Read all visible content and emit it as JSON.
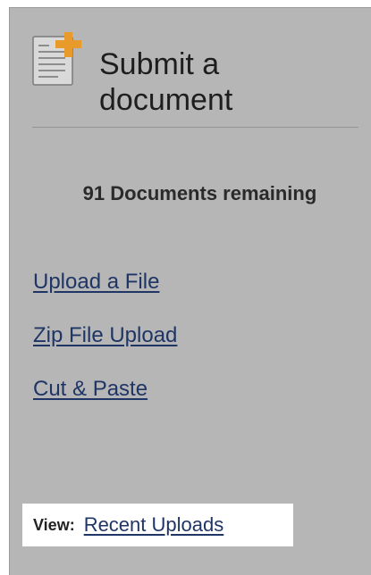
{
  "header": {
    "title_line1": "Submit a",
    "title_line2": "document",
    "icon": "document-add-icon"
  },
  "status": {
    "remaining_text": "91 Documents remaining"
  },
  "links": {
    "upload_file": "Upload a File",
    "zip_upload": "Zip File Upload",
    "cut_paste": "Cut & Paste"
  },
  "view": {
    "label": "View:",
    "recent_uploads": "Recent Uploads"
  },
  "colors": {
    "panel_bg": "#b6b6b6",
    "link": "#1f3566",
    "icon_plus": "#e89a2a"
  }
}
